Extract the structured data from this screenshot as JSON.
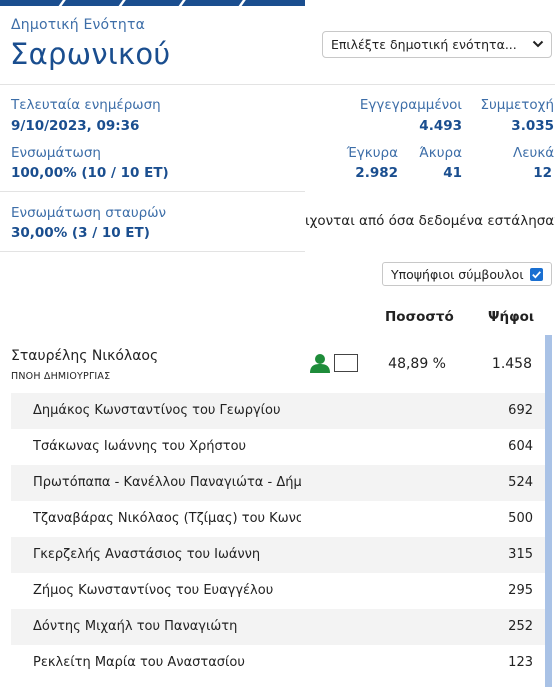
{
  "header": {
    "subtitle": "Δημοτική Ενότητα",
    "title": "Σαρωνικού"
  },
  "selector": {
    "selected": "Επιλέξτε δημοτική ενότητα..."
  },
  "status": {
    "last_update_label": "Τελευταία ενημέρωση",
    "last_update_value": "9/10/2023, 09:36",
    "integration_label": "Ενσωμάτωση",
    "integration_value": "100,00% (10 / 10 ΕΤ)",
    "cross_integration_label": "Ενσωμάτωση σταυρών",
    "cross_integration_value": "30,00% (3 / 10 ΕΤ)"
  },
  "stats": {
    "registered_label": "Εγγεγραμμένοι",
    "registered_value": "4.493",
    "participation_label": "Συμμετοχή",
    "participation_value": "3.035",
    "valid_label": "Έγκυρα",
    "valid_value": "2.982",
    "invalid_label": "Άκυρα",
    "invalid_value": "41",
    "blank_label": "Λευκά",
    "blank_value": "12"
  },
  "notice_text": "ιχονται από όσα δεδομένα εστάλησαν με SRT",
  "toggle": {
    "label": "Υποψήφιοι σύμβουλοι",
    "checked": true
  },
  "table": {
    "col_percent": "Ποσοστό",
    "col_votes": "Ψήφοι"
  },
  "party": {
    "name": "Σταυρέλης Νικόλαος",
    "list": "ΠΝΟΗ ΔΗΜΙΟΥΡΓΙΑΣ",
    "percent": "48,89 %",
    "votes": "1.458"
  },
  "candidates": [
    {
      "name": "Δημάκος Κωνσταντίνος του Γεωργίου",
      "votes": "692"
    },
    {
      "name": "Τσάκωνας Ιωάννης του Χρήστου",
      "votes": "604"
    },
    {
      "name": "Πρωτόπαπα - Κανέλλου Παναγιώτα - Δήμητρα",
      "votes": "524"
    },
    {
      "name": "Τζαναβάρας Νικόλαος (Τζίμας) του Κωνσταντίνου",
      "votes": "500"
    },
    {
      "name": "Γκερζελής Αναστάσιος του Ιωάννη",
      "votes": "315"
    },
    {
      "name": "Ζήμος Κωνσταντίνος του Ευαγγέλου",
      "votes": "295"
    },
    {
      "name": "Δόντης Μιχαήλ του Παναγιώτη",
      "votes": "252"
    },
    {
      "name": "Ρεκλείτη Μαρία του Αναστασίου",
      "votes": "123"
    }
  ],
  "colors": {
    "brand": "#1a4e8f",
    "label_blue": "#3d6ea8",
    "checkbox": "#1a6fd1",
    "person_icon": "#1e8c3a",
    "scrollbar": "#a9c2e6"
  },
  "icons": {
    "person": "person-icon",
    "chevron": "chevron-down-icon",
    "check": "check-icon"
  }
}
